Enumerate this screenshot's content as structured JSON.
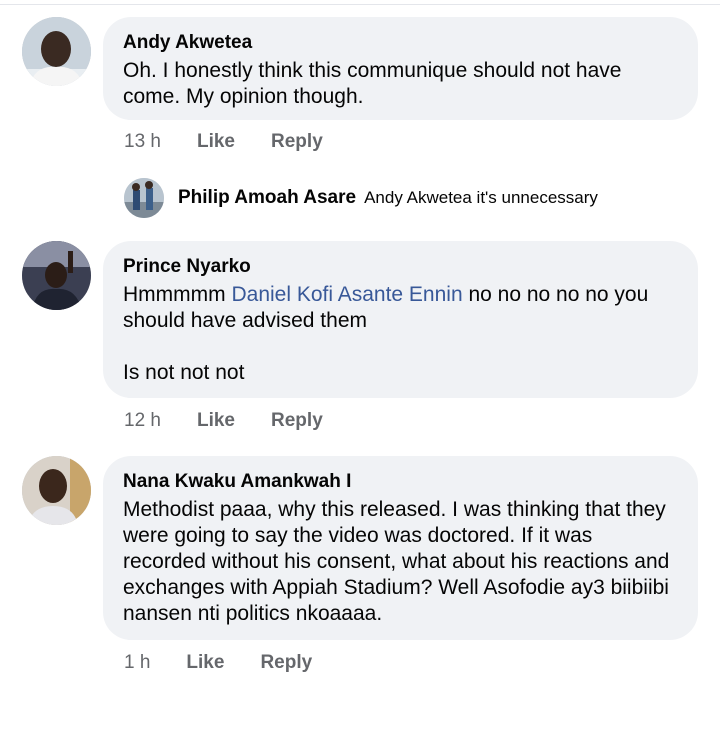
{
  "comments": [
    {
      "author": "Andy Akwetea",
      "text": "Oh. I honestly think this communique should not have come. My opinion though.",
      "time": "13 h",
      "like": "Like",
      "reply": "Reply"
    },
    {
      "author": "Prince Nyarko",
      "text_pre": "Hmmmmm ",
      "mention": "Daniel Kofi Asante Ennin",
      "text_post": " no no no no no you should have advised them\n\nIs not not not",
      "time": "12 h",
      "like": "Like",
      "reply": "Reply"
    },
    {
      "author": "Nana Kwaku Amankwah I",
      "text": "Methodist paaa, why this released. I was thinking that they were going to say the video was doctored. If it was recorded without his consent, what about his reactions and exchanges with Appiah Stadium? Well Asofodie ay3 biibiibi nansen nti politics nkoaaaa.",
      "time": "1 h",
      "like": "Like",
      "reply": "Reply"
    }
  ],
  "reply": {
    "author": "Philip Amoah Asare",
    "text": "Andy Akwetea it's unnecessary"
  },
  "colors": {
    "bubble": "#f0f2f5",
    "meta": "#65676b",
    "mention": "#385898"
  }
}
